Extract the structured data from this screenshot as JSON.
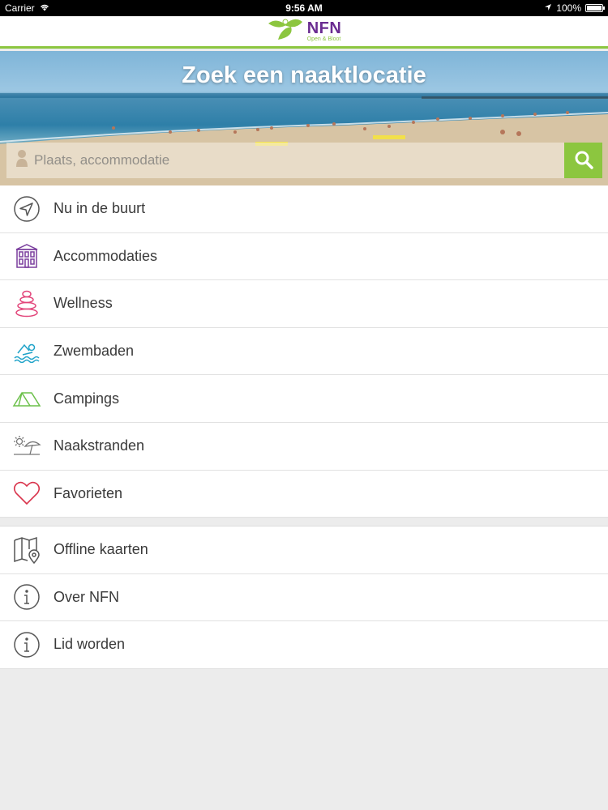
{
  "status_bar": {
    "carrier": "Carrier",
    "time": "9:56 AM",
    "battery": "100%",
    "battery_level": 1.0
  },
  "header": {
    "logo_name": "NFN",
    "logo_tagline": "Open & Bloot"
  },
  "hero": {
    "title": "Zoek een naaktlocatie",
    "search_placeholder": "Plaats, accommodatie"
  },
  "menu_primary": [
    {
      "label": "Nu in de buurt",
      "icon": "location-arrow-icon",
      "color": "#555555"
    },
    {
      "label": "Accommodaties",
      "icon": "building-icon",
      "color": "#7b3f9e"
    },
    {
      "label": "Wellness",
      "icon": "stones-icon",
      "color": "#e2457a"
    },
    {
      "label": "Zwembaden",
      "icon": "swimmer-icon",
      "color": "#1fa3c9"
    },
    {
      "label": "Campings",
      "icon": "tent-icon",
      "color": "#6cc04a"
    },
    {
      "label": "Naakstranden",
      "icon": "beach-umbrella-icon",
      "color": "#777777"
    },
    {
      "label": "Favorieten",
      "icon": "heart-icon",
      "color": "#d9344c"
    }
  ],
  "menu_secondary": [
    {
      "label": "Offline kaarten",
      "icon": "map-pin-icon",
      "color": "#555555"
    },
    {
      "label": "Over NFN",
      "icon": "info-icon",
      "color": "#555555"
    },
    {
      "label": "Lid worden",
      "icon": "info-icon",
      "color": "#555555"
    }
  ],
  "colors": {
    "accent_green": "#8cc63f",
    "brand_purple": "#6a2c91"
  }
}
